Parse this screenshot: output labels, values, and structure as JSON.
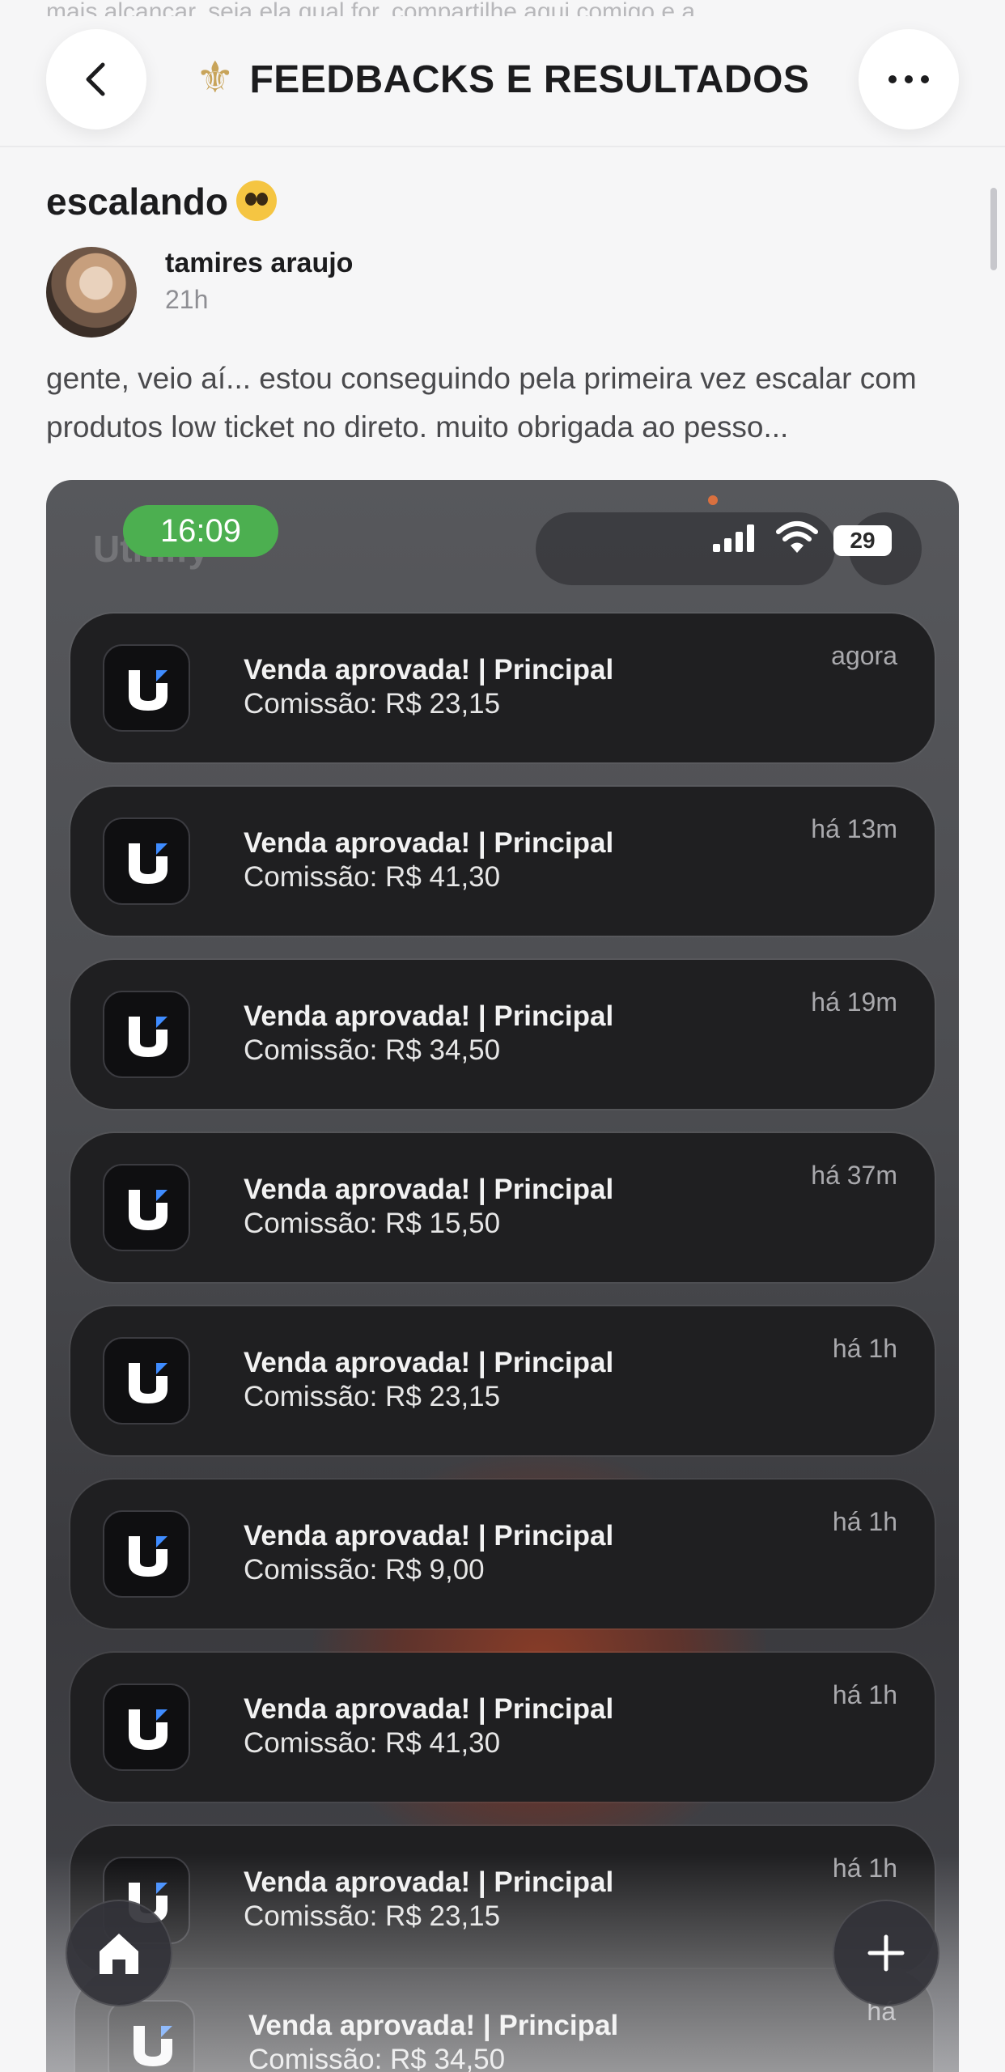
{
  "top_partial_text": "mais alcançar, seja ela qual for, compartilhe aqui comigo e a...",
  "nav": {
    "title": "FEEDBACKS E RESULTADOS",
    "title_icon": "fleur-de-lis-icon",
    "back_icon": "chevron-left-icon",
    "more_icon": "ellipsis-icon"
  },
  "post": {
    "title": "escalando",
    "title_emoji": "pleading-face-emoji",
    "author": "tamires araujo",
    "time": "21h",
    "body": "gente, veio aí... estou conseguindo pela primeira vez escalar com produtos low ticket no direto. muito obrigada ao pesso..."
  },
  "screenshot": {
    "clock": "16:09",
    "battery": "29",
    "notifications": [
      {
        "title": "Venda aprovada! | Principal",
        "subtitle": "Comissão: R$ 23,15",
        "time": "agora"
      },
      {
        "title": "Venda aprovada! | Principal",
        "subtitle": "Comissão: R$ 41,30",
        "time": "há 13m"
      },
      {
        "title": "Venda aprovada! | Principal",
        "subtitle": "Comissão: R$ 34,50",
        "time": "há 19m"
      },
      {
        "title": "Venda aprovada! | Principal",
        "subtitle": "Comissão: R$ 15,50",
        "time": "há 37m"
      },
      {
        "title": "Venda aprovada! | Principal",
        "subtitle": "Comissão: R$ 23,15",
        "time": "há 1h"
      },
      {
        "title": "Venda aprovada! | Principal",
        "subtitle": "Comissão: R$ 9,00",
        "time": "há 1h"
      },
      {
        "title": "Venda aprovada! | Principal",
        "subtitle": "Comissão: R$ 41,30",
        "time": "há 1h"
      },
      {
        "title": "Venda aprovada! | Principal",
        "subtitle": "Comissão: R$ 23,15",
        "time": "há 1h"
      },
      {
        "title": "Venda aprovada! | Principal",
        "subtitle": "Comissão: R$ 34,50",
        "time": "há"
      }
    ]
  },
  "floating": {
    "home_icon": "home-icon",
    "add_icon": "plus-icon"
  },
  "colors": {
    "accent_green": "#4caf50",
    "card_bg": "#1f1f21",
    "page_bg": "#f6f6f7"
  }
}
